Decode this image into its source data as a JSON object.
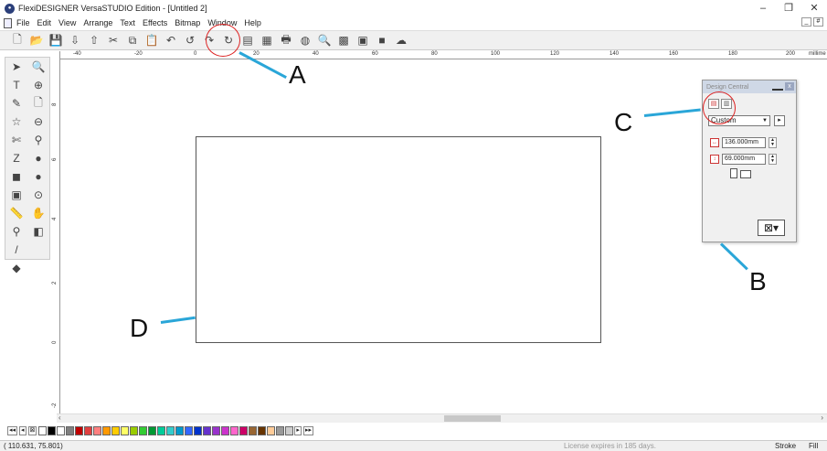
{
  "window": {
    "title": "FlexiDESIGNER VersaSTUDIO Edition - [Untitled 2]",
    "controls": [
      "–",
      "❐",
      "✕"
    ],
    "mdi_controls": [
      "_",
      "#"
    ]
  },
  "menu": {
    "items": [
      "File",
      "Edit",
      "View",
      "Arrange",
      "Text",
      "Effects",
      "Bitmap",
      "Window",
      "Help"
    ]
  },
  "ruler": {
    "h_labels": [
      "-40",
      "-20",
      "0",
      "20",
      "40",
      "60",
      "80",
      "100",
      "120",
      "140",
      "160",
      "180",
      "200",
      "millime"
    ],
    "v_labels": [
      "8",
      "6",
      "4",
      "2",
      "0",
      "-2"
    ]
  },
  "panel": {
    "title": "Design Central",
    "dropdown_value": "Custom",
    "width_value": "136.000mm",
    "height_value": "69.000mm"
  },
  "annotations": {
    "A": "A",
    "B": "B",
    "C": "C",
    "D": "D"
  },
  "status": {
    "coords": "( 110.631,  75.801)",
    "license": "License expires in 185 days.",
    "stroke_label": "Stroke",
    "fill_label": "Fill"
  },
  "palette": {
    "colors": [
      "#ffffff",
      "#000000",
      "#ffffff",
      "#7f7f7f",
      "#c00000",
      "#e04040",
      "#ff8080",
      "#ff9900",
      "#ffcc00",
      "#ffff66",
      "#99cc00",
      "#33cc33",
      "#009933",
      "#00cc99",
      "#33cccc",
      "#0099cc",
      "#3366ff",
      "#0033cc",
      "#6633cc",
      "#9933cc",
      "#cc33cc",
      "#ff66cc",
      "#cc0066",
      "#996633",
      "#663300",
      "#ffcc99",
      "#999999",
      "#cccccc"
    ]
  }
}
